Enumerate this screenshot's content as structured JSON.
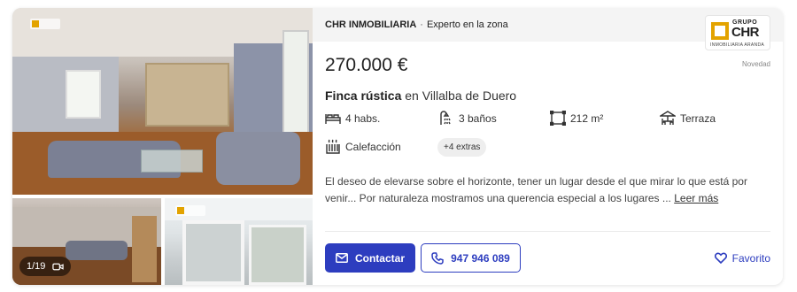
{
  "gallery": {
    "counter_text": "1/19",
    "icons": [
      "video-icon"
    ]
  },
  "agency": {
    "name": "CHR INMOBILIARIA",
    "separator": "·",
    "tagline": "Experto en la zona",
    "logo_line1": "GRUPO",
    "logo_line2": "CHR",
    "logo_line3": "INMOBILIARIA ARANDA",
    "logo_color": "#e3a300"
  },
  "listing": {
    "price": "270.000 €",
    "badge": "Novedad",
    "type": "Finca rústica",
    "location": "en Villalba de Duero",
    "features": [
      {
        "icon": "bed-icon",
        "label": "4 habs."
      },
      {
        "icon": "shower-icon",
        "label": "3 baños"
      },
      {
        "icon": "area-icon",
        "label": "212 m²"
      },
      {
        "icon": "terrace-icon",
        "label": "Terraza"
      },
      {
        "icon": "heating-icon",
        "label": "Calefacción"
      }
    ],
    "extras": "+4 extras",
    "description": "El deseo de elevarse sobre el horizonte, tener un lugar desde el que mirar lo que está por venir... Por naturaleza mostramos una querencia especial a los lugares ...",
    "read_more": "Leer más"
  },
  "actions": {
    "contact_label": "Contactar",
    "phone_label": "947 946 089",
    "favorite_label": "Favorito"
  },
  "colors": {
    "primary": "#2d3dbf",
    "agency_bar_bg": "#f4f4f4"
  }
}
